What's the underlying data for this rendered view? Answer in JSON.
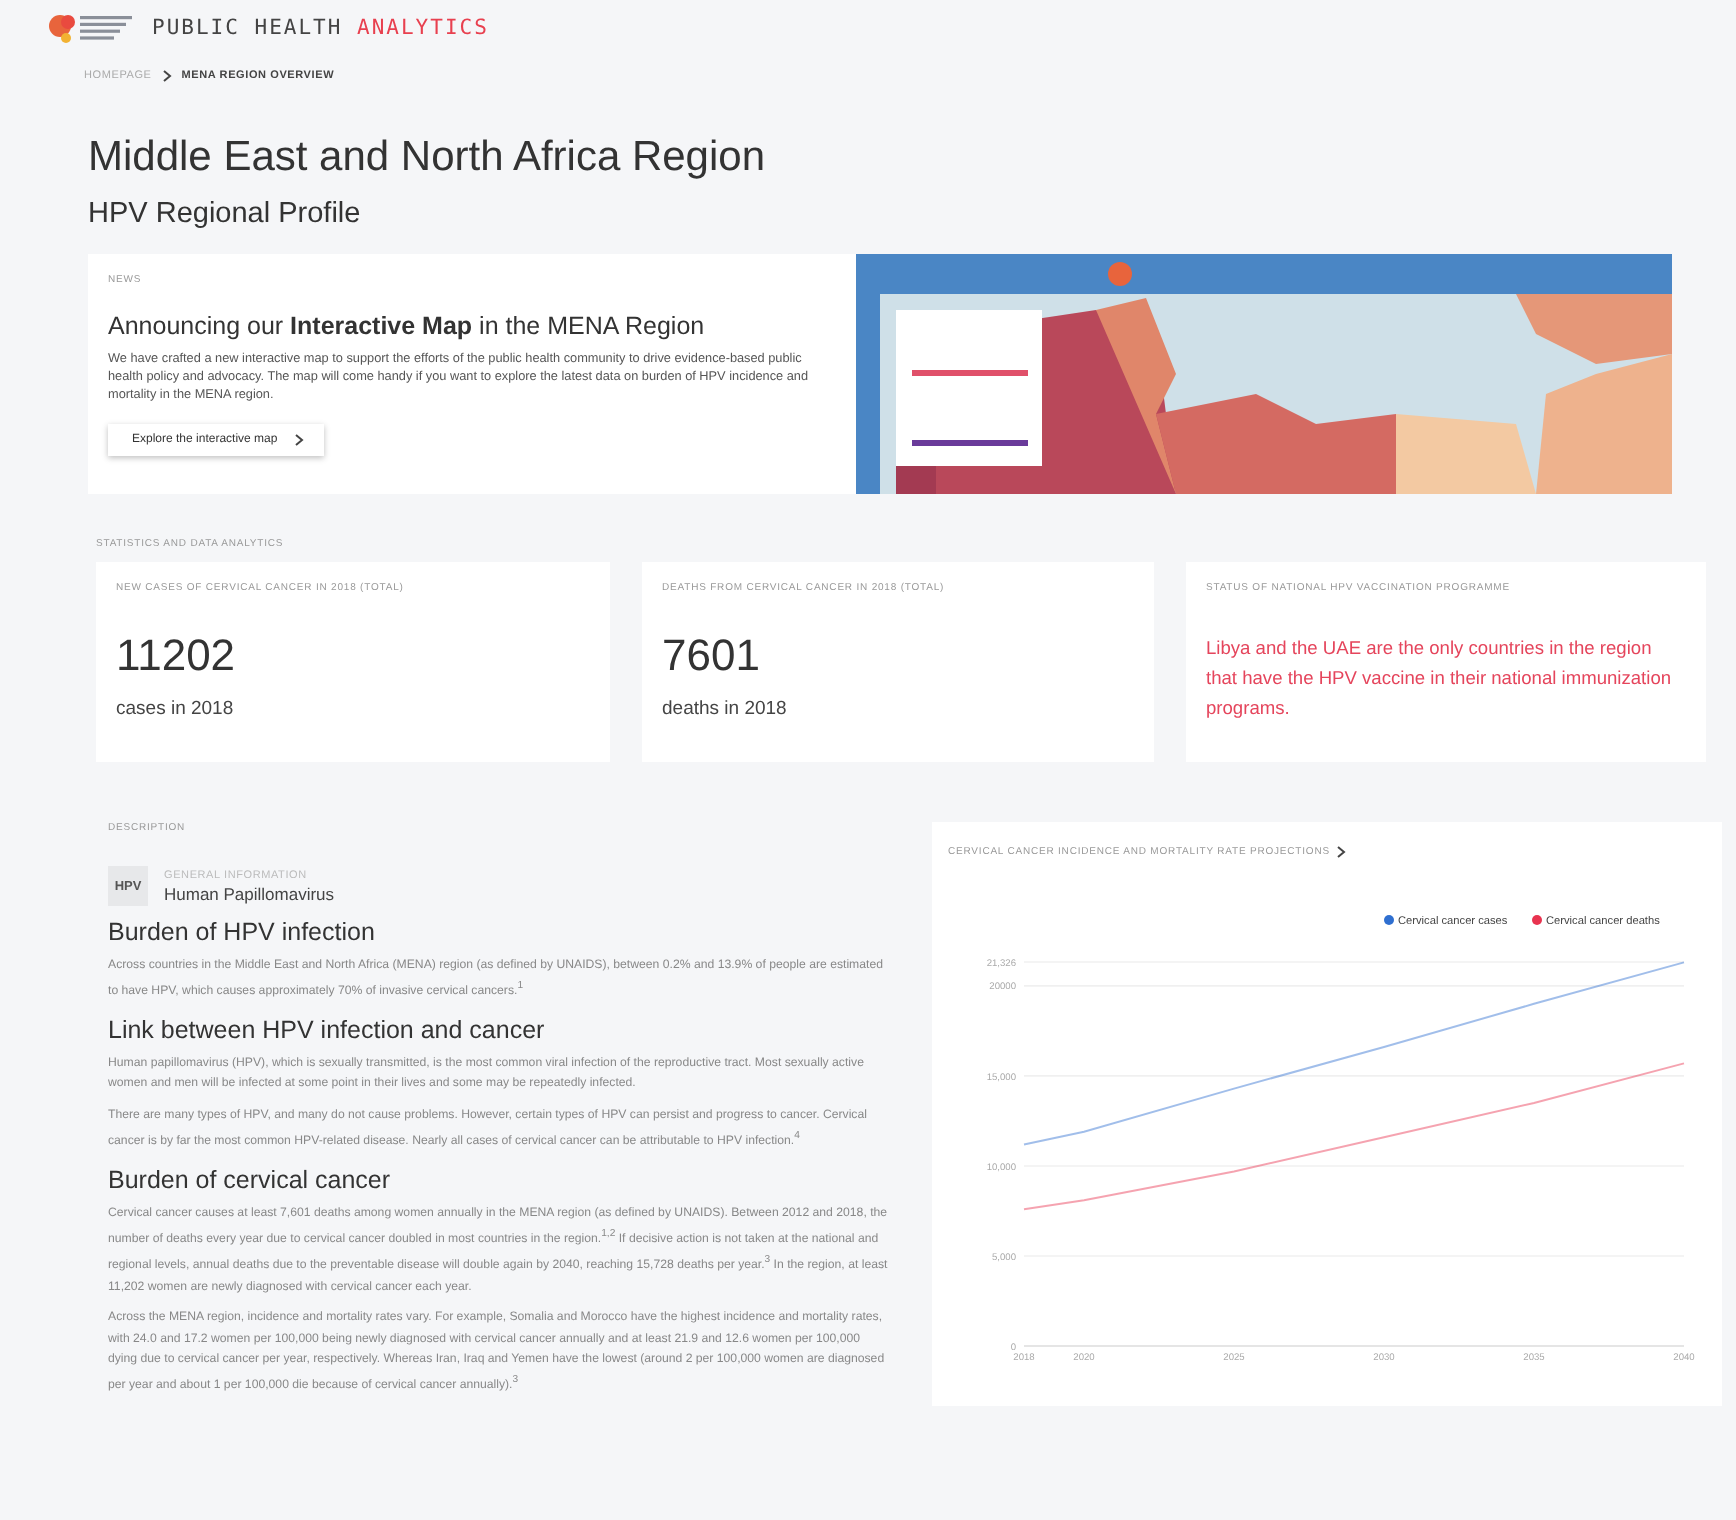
{
  "header": {
    "logo_text": "PUBLIC HEALTH",
    "logo_accent": "ANALYTICS"
  },
  "breadcrumb": [
    {
      "label": "HOMEPAGE",
      "current": false
    },
    {
      "label": "MENA REGION OVERVIEW",
      "current": true
    }
  ],
  "title": "Middle East and North Africa Region",
  "subtitle": "HPV Regional Profile",
  "news": {
    "label": "NEWS",
    "heading": "Announcing our **Interactive Map** in the MENA Region",
    "body": "We have crafted a new interactive map to support the efforts of the public health community to drive evidence-based public health policy and advocacy. The map will come handy if you want to explore the latest data on burden of HPV incidence and mortality in the MENA region.",
    "button": "Explore the interactive map"
  },
  "stats": {
    "label": "STATISTICS AND DATA ANALYTICS",
    "cards": [
      {
        "kind": "figure",
        "label": "NEW CASES OF CERVICAL CANCER IN 2018 (TOTAL)",
        "value": "11202",
        "caption": "cases in 2018"
      },
      {
        "kind": "figure",
        "label": "DEATHS FROM CERVICAL CANCER IN 2018 (TOTAL)",
        "value": "7601",
        "caption": "deaths in 2018"
      },
      {
        "kind": "note",
        "label": "STATUS OF NATIONAL HPV VACCINATION PROGRAMME",
        "text": "Libya and the UAE are the only countries in the region that have the HPV vaccine in their national immunization programs."
      }
    ]
  },
  "description": {
    "label": "DESCRIPTION",
    "badge": "HPV",
    "overline": "GENERAL INFORMATION",
    "name": "Human Papillomavirus",
    "sections": [
      {
        "heading": "Burden of HPV infection",
        "paragraphs": [
          "Across countries in the Middle East and North Africa (MENA) region (as defined by UNAIDS), between 0.2% and 13.9% of people are estimated to have HPV, which causes approximately 70% of invasive cervical cancers.$^{1}$"
        ]
      },
      {
        "heading": "Link between HPV infection and cancer",
        "paragraphs": [
          "Human papillomavirus (HPV), which is sexually transmitted, is the most common viral infection of the reproductive tract. Most sexually active women and men will be infected at some point in their lives and some may be repeatedly infected.",
          "There are many types of HPV, and many do not cause problems. However, certain types of HPV can persist and progress to cancer. Cervical cancer is by far the most common HPV-related disease. Nearly all cases of cervical cancer can be attributable to HPV infection.$^{4}$"
        ]
      },
      {
        "heading": "Burden of cervical cancer",
        "paragraphs": [
          "Cervical cancer causes at least 7,601 deaths among women annually in the MENA region (as defined by UNAIDS). Between 2012 and 2018, the number of deaths every year due to cervical cancer doubled in most countries in the region.$^{1,2}$ If decisive action is not taken at the national and regional levels, annual deaths due to the preventable disease will double again by 2040, reaching 15,728 deaths per year.$^{3}$ In the region, at least 11,202 women are newly diagnosed with cervical cancer each year.",
          "Across the MENA region, incidence and mortality rates vary. For example, Somalia and Morocco have the highest incidence and mortality rates, with 24.0 and 17.2 women per 100,000 being newly diagnosed with cervical cancer annually and at least 21.9 and 12.6 women per 100,000 dying due to cervical cancer per year, respectively. Whereas Iran, Iraq and Yemen have the lowest (around 2 per 100,000 women are diagnosed per year and about 1 per 100,000 die because of cervical cancer annually).$^{3}$"
        ]
      }
    ]
  },
  "chart_panel": {
    "title": "CERVICAL CANCER INCIDENCE AND MORTALITY RATE PROJECTIONS",
    "chart_data": {
      "type": "line",
      "grid": true,
      "legend": true,
      "x": [
        2018,
        2020,
        2025,
        2030,
        2035,
        2040
      ],
      "xlim": [
        2018,
        2040
      ],
      "ylim": [
        0,
        21326
      ],
      "xticks": [
        2018,
        2020,
        2025,
        2030,
        2035,
        2040
      ],
      "yticks": [
        0,
        {
          "value": 5000,
          "label": "5,000"
        },
        {
          "value": 10000,
          "label": "10,000"
        },
        {
          "value": 15000,
          "label": "15,000"
        },
        {
          "value": 20000,
          "label": "20000"
        },
        {
          "value": 21326,
          "label": "21,326"
        }
      ],
      "series": [
        {
          "name": "Cervical cancer cases",
          "color": "#2f6fd0",
          "values": [
            11200,
            11900,
            14300,
            16600,
            19000,
            21300
          ]
        },
        {
          "name": "Cervical cancer deaths",
          "color": "#e8334f",
          "values": [
            7600,
            8100,
            9700,
            11600,
            13500,
            15700
          ]
        }
      ]
    }
  }
}
